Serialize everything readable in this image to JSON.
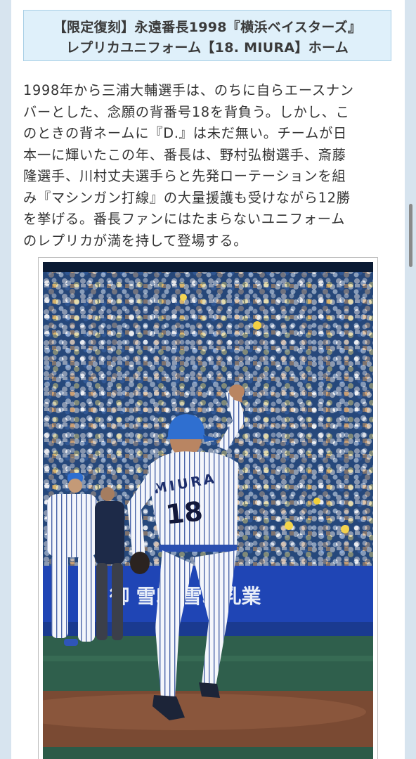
{
  "article": {
    "title_lines": [
      "【限定復刻】永遠番長1998『横浜ベイスターズ』",
      "レプリカユニフォーム【18. MIURA】ホーム"
    ],
    "body_lines": [
      "1998年から三浦大輔選手は、のちに自らエースナン",
      "バーとした、念願の背番号18を背負う。しかし、こ",
      "のときの背ネームに『D.』は未だ無い。チームが日",
      "本一に輝いたこの年、番長は、野村弘樹選手、斎藤",
      "隆選手、川村丈夫選手らと先発ローテーションを組",
      "み『マシンガン打線』の大量援護も受けながら12勝",
      "を挙げる。番長ファンにはたまらないユニフォーム",
      "のレプリカが満を持して登場する。"
    ]
  },
  "photo": {
    "jersey_name": "MIURA",
    "jersey_number": "18",
    "banner_text": "御 雪印 雪印乳業",
    "colors": {
      "cap": "#2f6fd0",
      "stand_blue": "#1f4f9a",
      "banner": "#1f45b5",
      "dirt": "#7a4a33",
      "grass": "#2f5f4c"
    }
  }
}
